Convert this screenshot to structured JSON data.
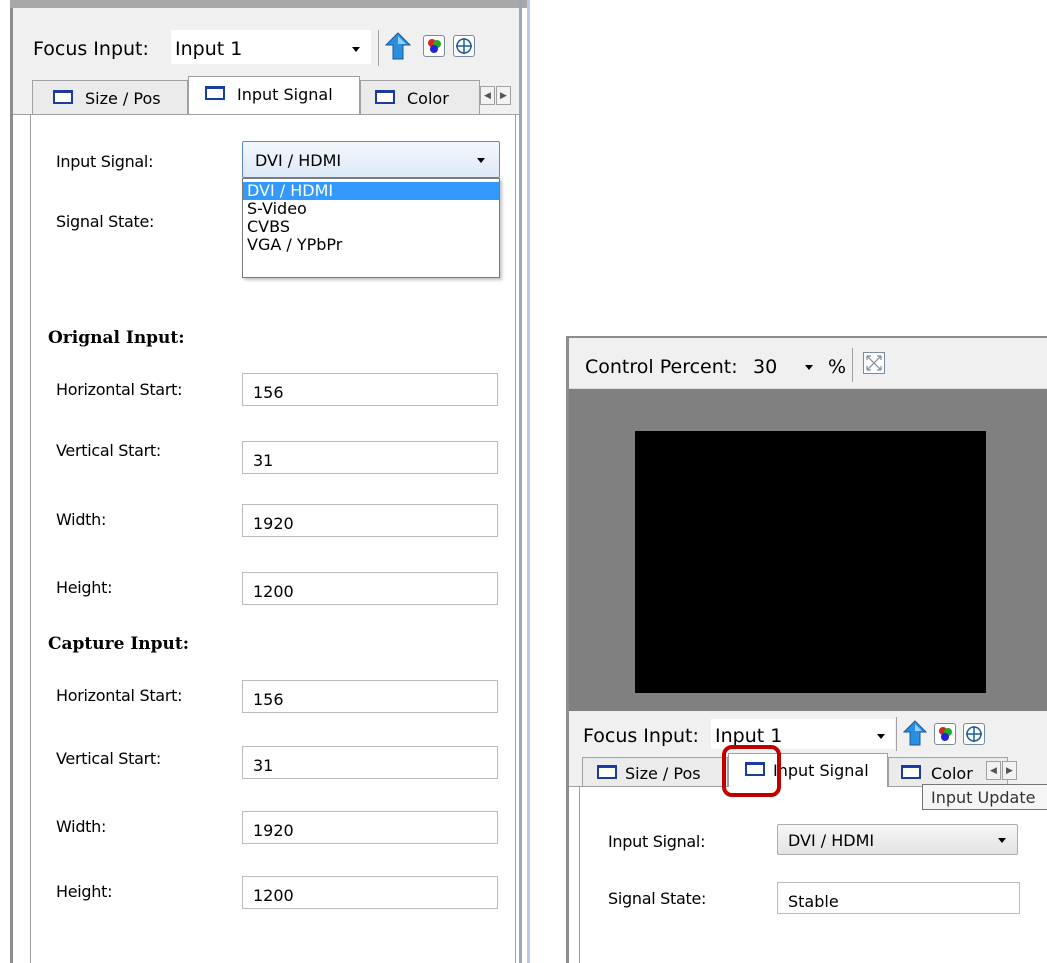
{
  "left_panel": {
    "toolbar": {
      "focus_label": "Focus Input:",
      "focus_value": "Input 1"
    },
    "tabs": [
      {
        "label": "Size / Pos"
      },
      {
        "label": "Input Signal"
      },
      {
        "label": "Color"
      }
    ],
    "input_signal": {
      "label": "Input Signal:",
      "value": "DVI / HDMI",
      "options": [
        "DVI / HDMI",
        "S-Video",
        "CVBS",
        "VGA / YPbPr"
      ]
    },
    "signal_state": {
      "label": "Signal State:"
    },
    "original": {
      "title": "Orignal Input:",
      "h_start_label": "Horizontal Start:",
      "h_start": "156",
      "v_start_label": "Vertical Start:",
      "v_start": "31",
      "width_label": "Width:",
      "width": "1920",
      "height_label": "Height:",
      "height": "1200"
    },
    "capture": {
      "title": "Capture Input:",
      "h_start_label": "Horizontal Start:",
      "h_start": "156",
      "v_start_label": "Vertical Start:",
      "v_start": "31",
      "width_label": "Width:",
      "width": "1920",
      "height_label": "Height:",
      "height": "1200"
    }
  },
  "right_panel": {
    "control_label": "Control Percent:",
    "control_value": "30",
    "percent_symbol": "%",
    "preview_colors": {
      "frame": "#808080",
      "screen": "#000000"
    },
    "toolbar": {
      "focus_label": "Focus Input:",
      "focus_value": "Input 1"
    },
    "tabs": [
      {
        "label": "Size / Pos"
      },
      {
        "label": "Input Signal"
      },
      {
        "label": "Color"
      }
    ],
    "tooltip": "Input Update",
    "input_signal": {
      "label": "Input Signal:",
      "value": "DVI / HDMI"
    },
    "signal_state": {
      "label": "Signal State:",
      "value": "Stable"
    },
    "highlight_color": "#c00000"
  }
}
